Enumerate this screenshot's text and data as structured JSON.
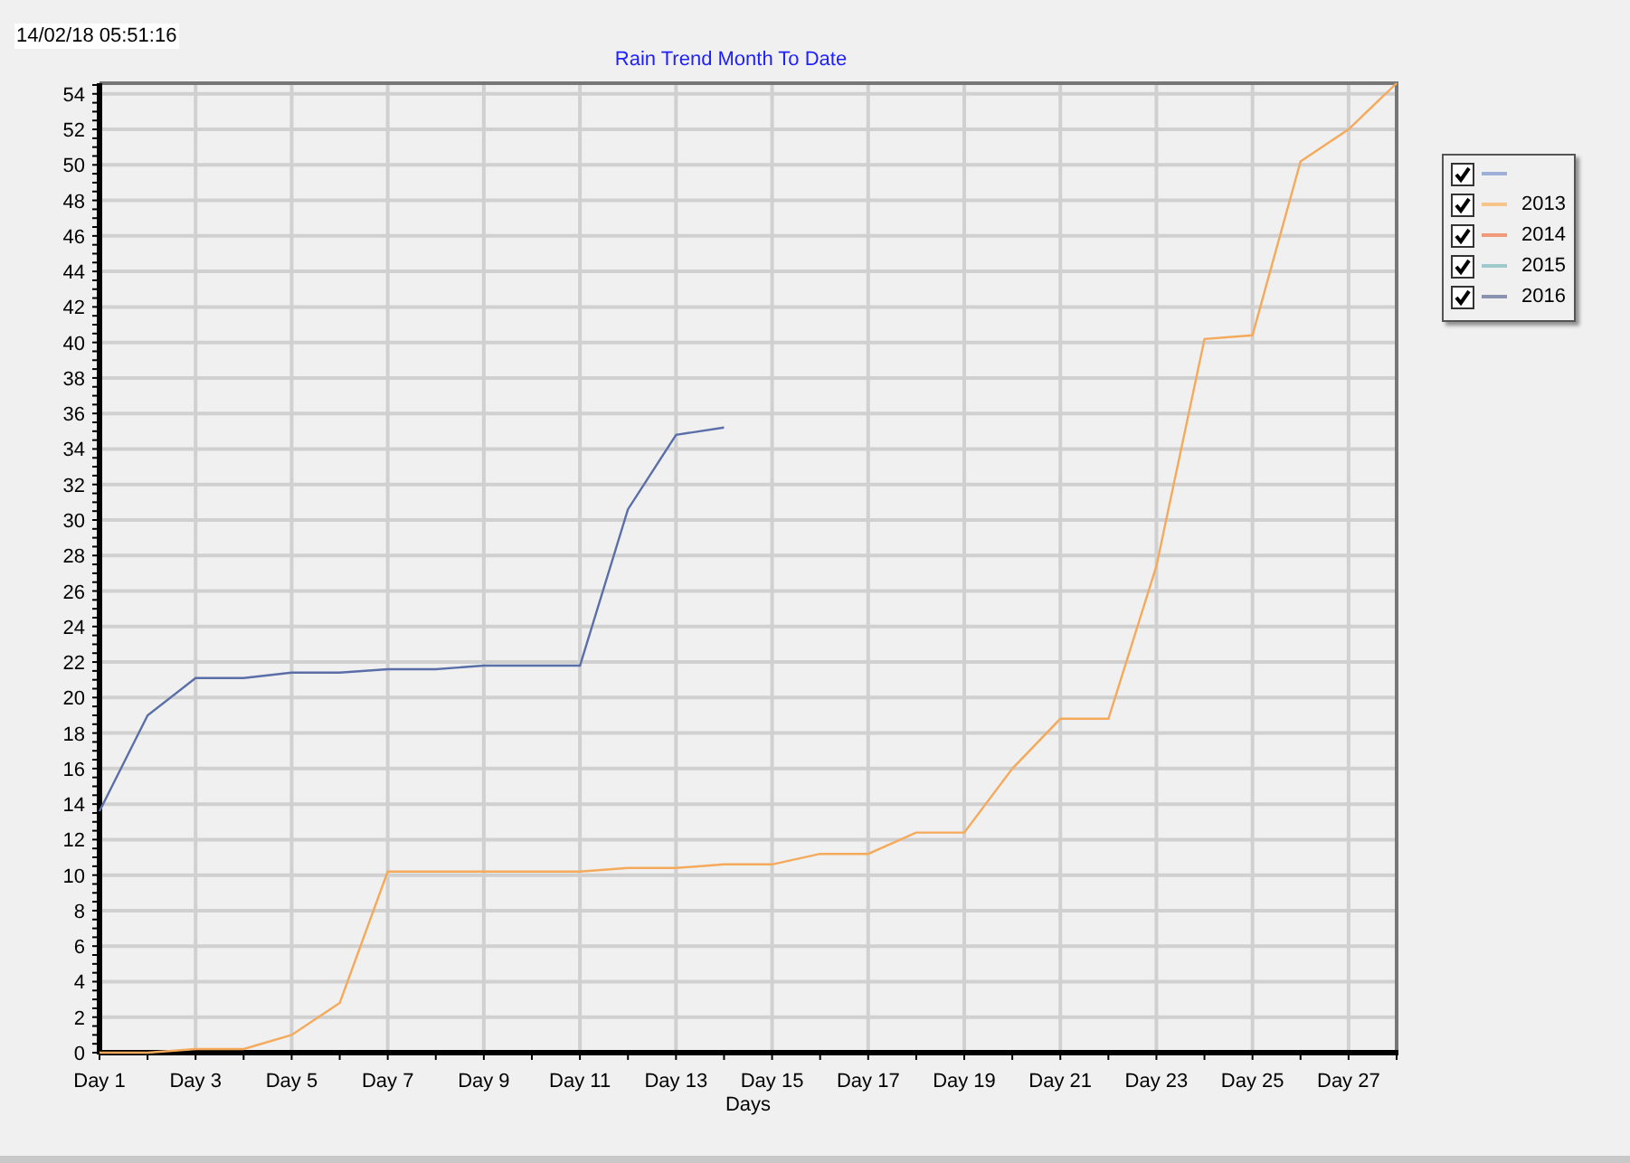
{
  "timestamp": "14/02/18 05:51:16",
  "chart": {
    "chart_data": {
      "type": "line",
      "title": "Rain Trend Month To Date",
      "xlabel": "Days",
      "categories": [
        "Day 1",
        null,
        "Day 3",
        null,
        "Day 5",
        null,
        "Day 7",
        null,
        "Day 9",
        null,
        "Day 11",
        null,
        "Day 13",
        null,
        "Day 15",
        null,
        "Day 17",
        null,
        "Day 19",
        null,
        "Day 21",
        null,
        "Day 23",
        null,
        "Day 25",
        null,
        "Day 27",
        null
      ],
      "series": [
        {
          "color": "#f5a95a",
          "values": [
            0,
            0,
            0.2,
            0.2,
            1.0,
            2.8,
            10.2,
            10.2,
            10.2,
            10.2,
            10.2,
            10.4,
            10.4,
            10.6,
            10.6,
            11.2,
            11.2,
            12.4,
            12.4,
            16.0,
            18.8,
            18.8,
            27.4,
            40.2,
            40.4,
            50.2,
            52.0,
            54.6
          ]
        },
        {
          "color": "#5a6ea8",
          "values": [
            13.6,
            19.0,
            21.1,
            21.1,
            21.4,
            21.4,
            21.6,
            21.6,
            21.8,
            21.8,
            21.8,
            30.6,
            34.8,
            35.2,
            null,
            null,
            null,
            null,
            null,
            null,
            null,
            null,
            null,
            null,
            null,
            null,
            null,
            null
          ]
        }
      ],
      "ylim": [
        0,
        54.6
      ],
      "grid": true,
      "yticks": [
        0,
        2,
        4,
        6,
        8,
        10,
        12,
        14,
        16,
        18,
        20,
        22,
        24,
        26,
        28,
        30,
        32,
        34,
        36,
        38,
        40,
        42,
        44,
        46,
        48,
        50,
        52,
        54
      ]
    }
  },
  "legend": {
    "items": [
      {
        "checked": true,
        "color": "#9fb0d8"
      },
      {
        "label": "2013",
        "checked": true,
        "color": "#f7c48a"
      },
      {
        "label": "2014",
        "checked": true,
        "color": "#f09a7a"
      },
      {
        "label": "2015",
        "checked": true,
        "color": "#9fc9cc"
      },
      {
        "label": "2016",
        "checked": true,
        "color": "#8a94b0"
      }
    ]
  }
}
